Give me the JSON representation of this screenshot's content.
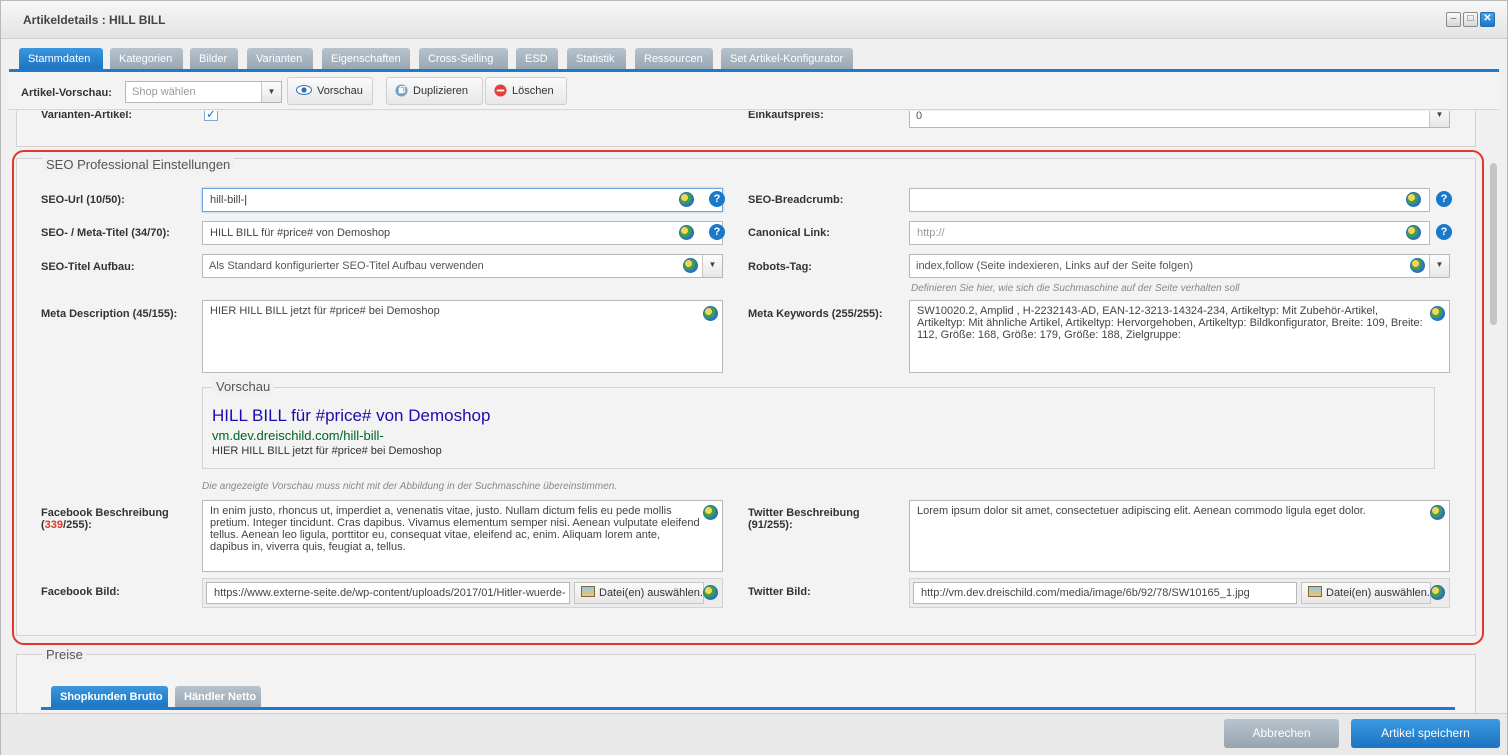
{
  "window": {
    "title": "Artikeldetails : HILL BILL",
    "controls": [
      "minimize",
      "maximize",
      "close"
    ]
  },
  "tabs": [
    "Stammdaten",
    "Kategorien",
    "Bilder",
    "Varianten",
    "Eigenschaften",
    "Cross-Selling",
    "ESD",
    "Statistik",
    "Ressourcen",
    "Set Artikel-Konfigurator"
  ],
  "toolbar": {
    "preview_label": "Artikel-Vorschau:",
    "shop_placeholder": "Shop wählen",
    "btn_preview": "Vorschau",
    "btn_duplicate": "Duplizieren",
    "btn_delete": "Löschen"
  },
  "top_row": {
    "variant_label": "Varianten-Artikel:",
    "variant_checked": true,
    "purchase_label": "Einkaufspreis:",
    "purchase_value": "0"
  },
  "seo": {
    "legend": "SEO Professional Einstellungen",
    "url_label": "SEO-Url (10/50):",
    "url_value": "hill-bill-",
    "breadcrumb_label": "SEO-Breadcrumb:",
    "breadcrumb_value": "",
    "meta_title_label": "SEO- / Meta-Titel (34/70):",
    "meta_title_value": "HILL BILL für #price# von Demoshop",
    "canonical_label": "Canonical Link:",
    "canonical_placeholder": "http://",
    "title_struct_label": "SEO-Titel Aufbau:",
    "title_struct_value": "Als Standard konfigurierter SEO-Titel Aufbau verwenden",
    "robots_label": "Robots-Tag:",
    "robots_value": "index,follow (Seite indexieren, Links auf der Seite folgen)",
    "robots_hint": "Definieren Sie hier, wie sich die Suchmaschine auf der Seite verhalten soll",
    "meta_desc_label": "Meta Description (45/155):",
    "meta_desc_value": "HIER HILL BILL jetzt für #price# bei Demoshop",
    "meta_kw_label": "Meta Keywords (255/255):",
    "meta_kw_value": "SW10020.2, Amplid , H-2232143-AD, EAN-12-3213-14324-234, Artikeltyp: Mit Zubehör-Artikel, Artikeltyp: Mit ähnliche Artikel, Artikeltyp: Hervorgehoben, Artikeltyp: Bildkonfigurator, Breite: 109, Breite: 112, Größe: 168, Größe: 179, Größe: 188, Zielgruppe:",
    "preview_legend": "Vorschau",
    "preview_title": "HILL BILL für #price# von Demoshop",
    "preview_url": "vm.dev.dreischild.com/hill-bill-",
    "preview_desc": "HIER HILL BILL jetzt für #price# bei Demoshop",
    "preview_hint": "Die angezeigte Vorschau muss nicht mit der Abbildung in der Suchmaschine übereinstimmen.",
    "fb_desc_label": "Facebook Beschreibung",
    "fb_desc_count": "339",
    "fb_desc_max": "/255):",
    "fb_desc_open": "(",
    "fb_desc_value": "In enim justo, rhoncus ut, imperdiet a, venenatis vitae, justo. Nullam dictum felis eu pede mollis pretium. Integer tincidunt. Cras dapibus. Vivamus elementum semper nisi. Aenean vulputate eleifend tellus. Aenean leo ligula, porttitor eu, consequat vitae, eleifend ac, enim. Aliquam lorem ante, dapibus in, viverra quis, feugiat a, tellus.",
    "tw_desc_label": "Twitter Beschreibung",
    "tw_desc_count": "(91/255):",
    "tw_desc_value": "Lorem ipsum dolor sit amet, consectetuer adipiscing elit. Aenean commodo ligula eget dolor.",
    "fb_img_label": "Facebook Bild:",
    "fb_img_value": "https://www.externe-seite.de/wp-content/uploads/2017/01/Hitler-wuerde-",
    "tw_img_label": "Twitter Bild:",
    "tw_img_value": "http://vm.dev.dreischild.com/media/image/6b/92/78/SW10165_1.jpg",
    "file_btn": "Datei(en) auswählen..."
  },
  "prices": {
    "legend": "Preise",
    "tabs": [
      "Shopkunden Brutto",
      "Händler Netto"
    ]
  },
  "footer": {
    "cancel": "Abbrechen",
    "save": "Artikel speichern"
  },
  "colors": {
    "accent": "#1b73c2",
    "highlight_border": "#e4352c",
    "count_over": "#e4352c"
  }
}
